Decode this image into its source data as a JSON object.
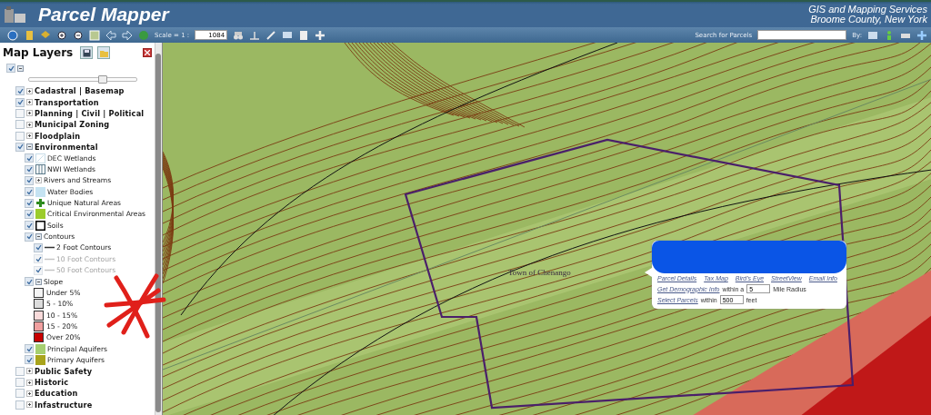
{
  "header": {
    "title": "Parcel Mapper",
    "org_lines": [
      "GIS and Mapping Services",
      "Broome County, New York"
    ]
  },
  "toolbar": {
    "scale_label": "Scale = 1 :",
    "scale_value": "1084",
    "search_label": "Search for Parcels",
    "by_label": "By:"
  },
  "layers_panel": {
    "title": "Map Layers",
    "root_checked": true,
    "opacity": {
      "level": 0.68
    },
    "layers": [
      {
        "kind": "group",
        "label": "Cadastral | Basemap",
        "checked": true,
        "expanded": false
      },
      {
        "kind": "group",
        "label": "Transportation",
        "checked": true,
        "expanded": false
      },
      {
        "kind": "group",
        "label": "Planning | Civil | Political",
        "checked": false,
        "expanded": false
      },
      {
        "kind": "group",
        "label": "Municipal Zoning",
        "checked": false,
        "expanded": false
      },
      {
        "kind": "group",
        "label": "Floodplain",
        "checked": false,
        "expanded": false
      },
      {
        "kind": "group",
        "label": "Environmental",
        "checked": true,
        "expanded": true,
        "children": [
          {
            "kind": "hatch",
            "label": "DEC Wetlands",
            "checked": true,
            "disabled": false,
            "color": "#c8dde8"
          },
          {
            "kind": "grid",
            "label": "NWI Wetlands",
            "checked": true,
            "disabled": false,
            "color": "#5a7a8a"
          },
          {
            "kind": "group",
            "label": "Rivers and Streams",
            "checked": true,
            "expanded": false
          },
          {
            "kind": "fill",
            "label": "Water Bodies",
            "checked": true,
            "disabled": false,
            "color": "#c5e3f2"
          },
          {
            "kind": "cross",
            "label": "Unique Natural Areas",
            "checked": true,
            "disabled": false,
            "color": "#2e8b1e"
          },
          {
            "kind": "fill",
            "label": "Critical Environmental Areas",
            "checked": true,
            "disabled": false,
            "color": "#9ccc2c"
          },
          {
            "kind": "outline",
            "label": "Soils",
            "checked": true,
            "disabled": false,
            "color": "#000000"
          },
          {
            "kind": "group",
            "label": "Contours",
            "checked": true,
            "expanded": true,
            "children": [
              {
                "kind": "line",
                "label": "2 Foot Contours",
                "checked": true,
                "disabled": false,
                "color": "#333333"
              },
              {
                "kind": "line",
                "label": "10 Foot Contours",
                "checked": true,
                "disabled": true,
                "color": "#c4c4c4"
              },
              {
                "kind": "line",
                "label": "50 Foot Contours",
                "checked": true,
                "disabled": true,
                "color": "#c4c4c4"
              }
            ]
          },
          {
            "kind": "group",
            "label": "Slope",
            "checked": true,
            "expanded": true,
            "children": [
              {
                "kind": "legend",
                "label": "Under 5%",
                "color": "#f4f4f4"
              },
              {
                "kind": "legend",
                "label": "5 - 10%",
                "color": "#dcdcdc"
              },
              {
                "kind": "legend",
                "label": "10 - 15%",
                "color": "#f8dada"
              },
              {
                "kind": "legend",
                "label": "15 - 20%",
                "color": "#f0a0a0"
              },
              {
                "kind": "legend",
                "label": "Over 20%",
                "color": "#c80000"
              }
            ]
          },
          {
            "kind": "fill",
            "label": "Principal Aquifers",
            "checked": true,
            "disabled": false,
            "color": "#a6cf70"
          },
          {
            "kind": "fill",
            "label": "Primary Aquifers",
            "checked": true,
            "disabled": false,
            "color": "#a9a41c"
          }
        ]
      },
      {
        "kind": "group",
        "label": "Public Safety",
        "checked": false,
        "expanded": false
      },
      {
        "kind": "group",
        "label": "Historic",
        "checked": false,
        "expanded": false
      },
      {
        "kind": "group",
        "label": "Education",
        "checked": false,
        "expanded": false
      },
      {
        "kind": "group",
        "label": "Infastructure",
        "checked": false,
        "expanded": false
      }
    ]
  },
  "map": {
    "place_label": "Town of Chenango",
    "popup": {
      "links": [
        "Parcel Details",
        "Tax Map",
        "Bird's Eye",
        "StreetView",
        "Email Info"
      ],
      "demographic_link": "Get Demographic Info",
      "within_a": "within a",
      "radius_value": "5",
      "radius_unit": "Mile Radius",
      "select_link": "Select Parcels",
      "within": "within",
      "feet_value": "500",
      "feet_unit": "feet"
    }
  }
}
